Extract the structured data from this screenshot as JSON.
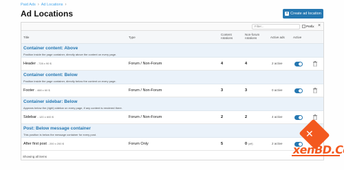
{
  "breadcrumb": {
    "items": [
      "Paid Ads",
      "Ad Locations"
    ]
  },
  "page": {
    "title": "Ad Locations",
    "create_button": "Create ad location"
  },
  "filter": {
    "placeholder": "Filter...",
    "prefix_label": "Prefix"
  },
  "table": {
    "headers": {
      "title": "Title",
      "type": "Type",
      "content_rotations": "Content rotations",
      "nonforum_rotations": "Non-forum rotations",
      "active_ads": "Active ads",
      "active": "Active"
    },
    "groups": [
      {
        "title": "Container content: Above",
        "desc": "Position inside the page container, directly above the content on every page.",
        "row": {
          "title": "Header",
          "size": "- 728 x 90 $",
          "type": "Forum / Non-Forum",
          "rot": "4",
          "nf": "4",
          "nf_note": "",
          "active": "2 active"
        }
      },
      {
        "title": "Container content: Below",
        "desc": "Position inside the page container, directly below the content on every page.",
        "row": {
          "title": "Footer",
          "size": "- 468 x 60 $",
          "type": "Forum / Non-Forum",
          "rot": "3",
          "nf": "3",
          "nf_note": "",
          "active": "0 active"
        }
      },
      {
        "title": "Container sidebar: Below",
        "desc": "Appears below the (right) sidebar on every page, if any content is rendered there.",
        "row": {
          "title": "Sidebar",
          "size": "- 120 x 600 $",
          "type": "Forum / Non-Forum",
          "rot": "2",
          "nf": "2",
          "nf_note": "",
          "active": "4 active"
        }
      },
      {
        "title": "Post: Below message container",
        "desc": "This position is below the message container for every post.",
        "row": {
          "title": "After first post",
          "size": "- 200 x 200 $",
          "type": "Forum Only",
          "rot": "5",
          "nf": "0",
          "nf_note": "(off)",
          "active": "2 active"
        }
      }
    ],
    "footer": "Showing all items"
  },
  "watermark": {
    "text": "xenBD.Com"
  },
  "colors": {
    "accent": "#2577b1",
    "link": "#47a7eb",
    "group_bg": "#eaf2fa",
    "watermark": "#f3591f"
  }
}
